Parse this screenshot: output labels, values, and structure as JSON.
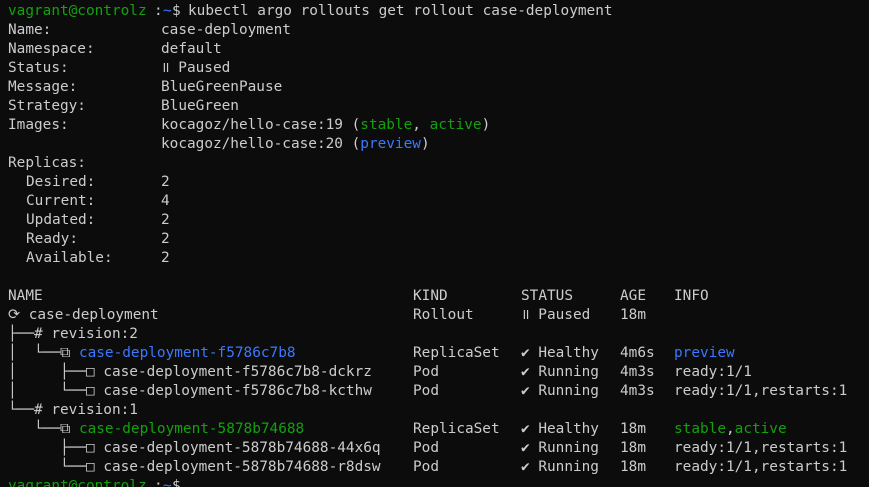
{
  "colors": {
    "background": "#0c0c0c",
    "foreground": "#cccccc",
    "green": "#13a10e",
    "blue": "#3b78ff"
  },
  "prompt": {
    "user_host": "vagrant@controlz",
    "sep": ":",
    "path": "~",
    "symbol": "$",
    "command": "kubectl argo rollouts get rollout case-deployment"
  },
  "summary": {
    "name_label": "Name:",
    "name_value": "case-deployment",
    "namespace_label": "Namespace:",
    "namespace_value": "default",
    "status_label": "Status:",
    "status_value": "॥ Paused",
    "message_label": "Message:",
    "message_value": "BlueGreenPause",
    "strategy_label": "Strategy:",
    "strategy_value": "BlueGreen",
    "images_label": "Images:",
    "image1_name": "kocagoz/hello-case:19",
    "image1_open": " (",
    "image1_tag1": "stable",
    "image1_comma": ", ",
    "image1_tag2": "active",
    "image1_close": ")",
    "image2_name": "kocagoz/hello-case:20",
    "image2_open": " (",
    "image2_tag": "preview",
    "image2_close": ")"
  },
  "replicas": {
    "title": "Replicas:",
    "desired_label": "Desired:",
    "desired_value": "2",
    "current_label": "Current:",
    "current_value": "4",
    "updated_label": "Updated:",
    "updated_value": "2",
    "ready_label": "Ready:",
    "ready_value": "2",
    "available_label": "Available:",
    "available_value": "2"
  },
  "table": {
    "headers": {
      "name": "NAME",
      "kind": "KIND",
      "status": "STATUS",
      "age": "AGE",
      "info": "INFO"
    },
    "rows": [
      {
        "tree": "⟳ ",
        "name": "case-deployment",
        "kind": "Rollout",
        "status": "॥ Paused",
        "age": "18m",
        "info": ""
      },
      {
        "tree": "├──# ",
        "name": "revision:2",
        "kind": "",
        "status": "",
        "age": "",
        "info": ""
      },
      {
        "tree": "│  └──⧉ ",
        "name": "case-deployment-f5786c7b8",
        "kind": "ReplicaSet",
        "status": "✔ Healthy",
        "age": "4m6s",
        "info": "preview"
      },
      {
        "tree": "│     ├──□ ",
        "name": "case-deployment-f5786c7b8-dckrz",
        "kind": "Pod",
        "status": "✔ Running",
        "age": "4m3s",
        "info": "ready:1/1"
      },
      {
        "tree": "│     └──□ ",
        "name": "case-deployment-f5786c7b8-kcthw",
        "kind": "Pod",
        "status": "✔ Running",
        "age": "4m3s",
        "info": "ready:1/1,restarts:1"
      },
      {
        "tree": "└──# ",
        "name": "revision:1",
        "kind": "",
        "status": "",
        "age": "",
        "info": ""
      },
      {
        "tree": "   └──⧉ ",
        "name": "case-deployment-5878b74688",
        "kind": "ReplicaSet",
        "status": "✔ Healthy",
        "age": "18m",
        "info_part1": "stable",
        "info_sep": ",",
        "info_part2": "active"
      },
      {
        "tree": "      ├──□ ",
        "name": "case-deployment-5878b74688-44x6q",
        "kind": "Pod",
        "status": "✔ Running",
        "age": "18m",
        "info": "ready:1/1,restarts:1"
      },
      {
        "tree": "      └──□ ",
        "name": "case-deployment-5878b74688-r8dsw",
        "kind": "Pod",
        "status": "✔ Running",
        "age": "18m",
        "info": "ready:1/1,restarts:1"
      }
    ]
  },
  "prompt2": {
    "user_host": "vagrant@controlz",
    "sep": ":",
    "path": "~",
    "symbol": "$"
  }
}
